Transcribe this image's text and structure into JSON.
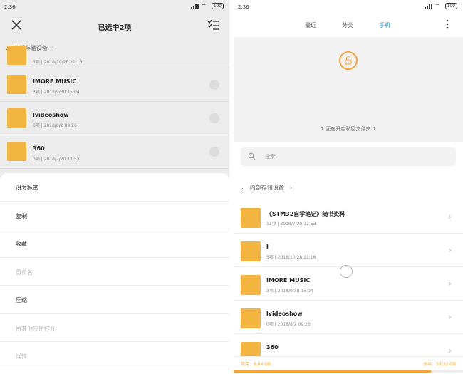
{
  "left": {
    "status": {
      "time": "2:36",
      "battery": "100"
    },
    "header": {
      "title": "已选中2项"
    },
    "breadcrumb": {
      "label": "内部存储设备"
    },
    "partial_row": {
      "meta": "5项 | 2018/10/28 21:16"
    },
    "rows": [
      {
        "name": "IMORE MUSIC",
        "meta": "3项 | 2018/9/30 15:04"
      },
      {
        "name": "lvideoshow",
        "meta": "0项 | 2018/8/2 09:26"
      },
      {
        "name": "360",
        "meta": "0项 | 2018/7/20 12:53"
      }
    ],
    "menu": [
      {
        "label": "设为私密",
        "enabled": true
      },
      {
        "label": "复制",
        "enabled": true
      },
      {
        "label": "收藏",
        "enabled": true
      },
      {
        "label": "重命名",
        "enabled": false
      },
      {
        "label": "压缩",
        "enabled": true
      },
      {
        "label": "用其他应用打开",
        "enabled": false
      },
      {
        "label": "详情",
        "enabled": false
      }
    ]
  },
  "right": {
    "status": {
      "time": "2:36",
      "battery": "100"
    },
    "tabs": [
      {
        "label": "最近",
        "active": false
      },
      {
        "label": "分类",
        "active": false
      },
      {
        "label": "手机",
        "active": true
      }
    ],
    "vault_text": "↑ 正在开启私密文件夹 ↑",
    "search_placeholder": "搜索",
    "breadcrumb": {
      "label": "内部存储设备"
    },
    "rows": [
      {
        "name": "《STM32自学笔记》随书资料",
        "meta": "11项 | 2018/7/20 12:53"
      },
      {
        "name": "I",
        "meta": "5项 | 2018/10/28 21:16"
      },
      {
        "name": "IMORE MUSIC",
        "meta": "3项 | 2018/9/30 15:04"
      },
      {
        "name": "lvideoshow",
        "meta": "0项 | 2018/8/2 09:26"
      },
      {
        "name": "360",
        "meta": ""
      }
    ],
    "storage": {
      "used": "可用：8.04 GB",
      "total": "总共：57.32 GB",
      "used_fraction": 0.86
    }
  },
  "colors": {
    "accent": "#1e8fd6",
    "folder": "#f2b53f",
    "vault_ring": "#f5a43b"
  }
}
